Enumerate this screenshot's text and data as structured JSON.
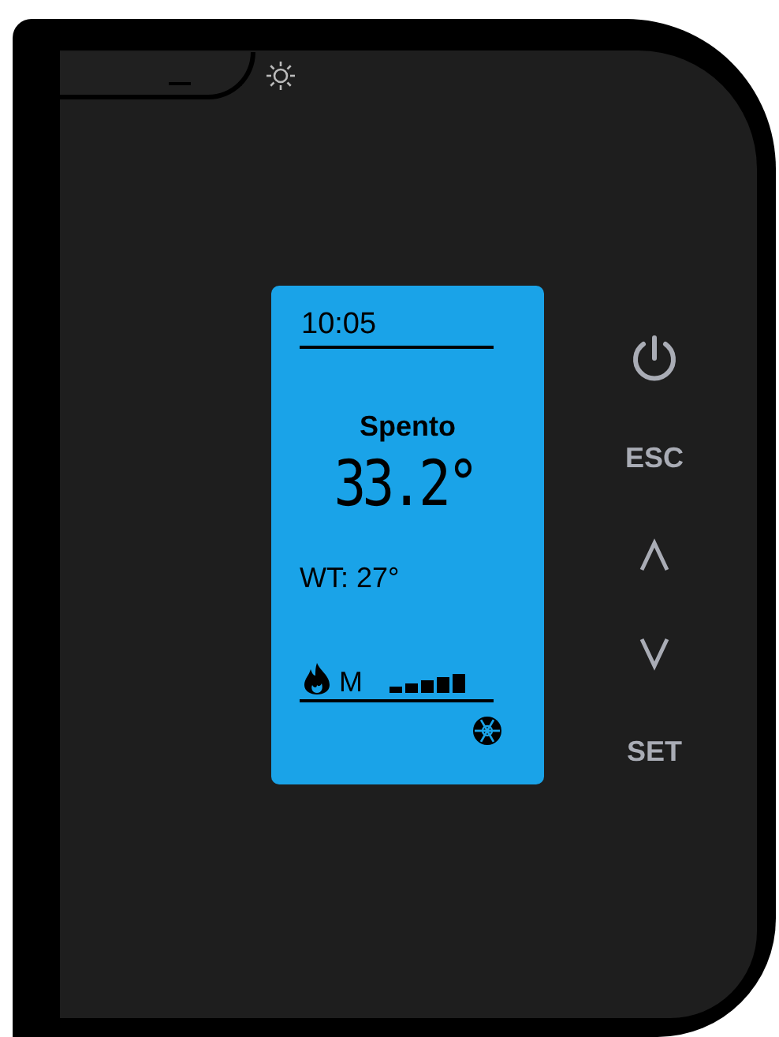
{
  "display": {
    "time": "10:05",
    "status": "Spento",
    "temperature": "33.2°",
    "water_temp": "WT: 27°",
    "power_mode": "M"
  },
  "buttons": [
    {
      "kind": "power"
    },
    {
      "kind": "text",
      "label": "ESC"
    },
    {
      "kind": "up"
    },
    {
      "kind": "down"
    },
    {
      "kind": "text",
      "label": "SET"
    }
  ]
}
